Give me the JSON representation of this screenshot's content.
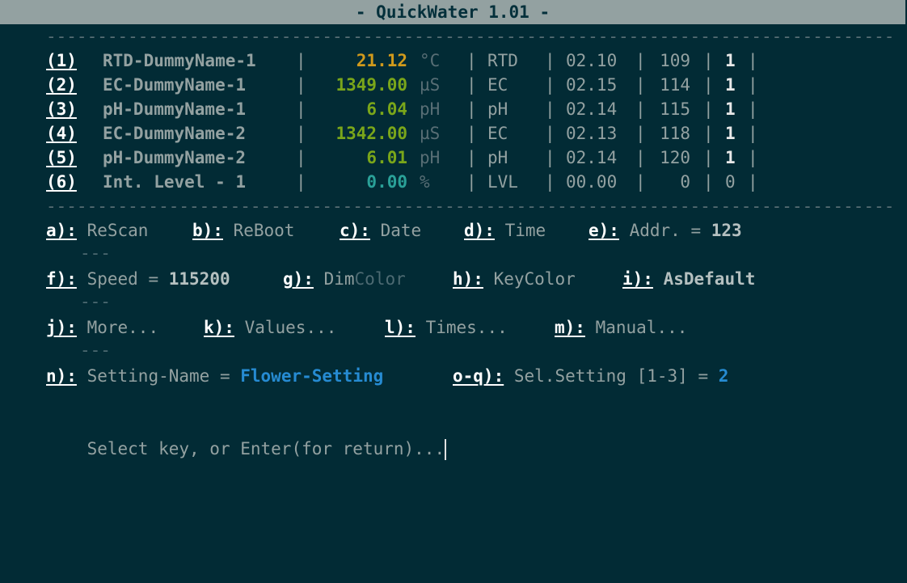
{
  "title": "- QuickWater 1.01 -",
  "rule": "-----------------------------------------------------------------------------------",
  "sensors": [
    {
      "key": "(1)",
      "name": "RTD-DummyName-1",
      "value": "21.12",
      "unit": "°C",
      "type": "RTD",
      "version": "02.10",
      "address": "109",
      "flag": "1",
      "color": "orange"
    },
    {
      "key": "(2)",
      "name": "EC-DummyName-1",
      "value": "1349.00",
      "unit": "µS",
      "type": "EC",
      "version": "02.15",
      "address": "114",
      "flag": "1",
      "color": "green"
    },
    {
      "key": "(3)",
      "name": "pH-DummyName-1",
      "value": "6.04",
      "unit": "pH",
      "type": "pH",
      "version": "02.14",
      "address": "115",
      "flag": "1",
      "color": "green"
    },
    {
      "key": "(4)",
      "name": "EC-DummyName-2",
      "value": "1342.00",
      "unit": "µS",
      "type": "EC",
      "version": "02.13",
      "address": "118",
      "flag": "1",
      "color": "green"
    },
    {
      "key": "(5)",
      "name": "pH-DummyName-2",
      "value": "6.01",
      "unit": "pH",
      "type": "pH",
      "version": "02.14",
      "address": "120",
      "flag": "1",
      "color": "green"
    },
    {
      "key": "(6)",
      "name": "Int. Level - 1",
      "value": "0.00",
      "unit": "%",
      "type": "LVL",
      "version": "00.00",
      "address": "0",
      "flag": "0",
      "color": "teal"
    }
  ],
  "separator": "|",
  "menu": {
    "a": {
      "key": "a):",
      "label": "ReScan"
    },
    "b": {
      "key": "b):",
      "label": "ReBoot"
    },
    "c": {
      "key": "c):",
      "label": "Date"
    },
    "d": {
      "key": "d):",
      "label": "Time"
    },
    "e": {
      "key": "e):",
      "label": "Addr. = ",
      "value": "123"
    },
    "f": {
      "key": "f):",
      "label": "Speed = ",
      "value": "115200"
    },
    "g": {
      "key": "g):",
      "label_a": "Dim",
      "label_b": "Color"
    },
    "h": {
      "key": "h):",
      "label": "KeyColor"
    },
    "i": {
      "key": "i):",
      "label": "AsDefault"
    },
    "j": {
      "key": "j):",
      "label": "More..."
    },
    "k": {
      "key": "k):",
      "label": "Values..."
    },
    "l": {
      "key": "l):",
      "label": "Times..."
    },
    "m": {
      "key": "m):",
      "label": "Manual..."
    },
    "n": {
      "key": "n):",
      "label": "Setting-Name = ",
      "value": "Flower-Setting"
    },
    "oq": {
      "key": "o-q):",
      "label": "Sel.Setting [1-3] = ",
      "value": "2"
    },
    "row_divider": "---"
  },
  "prompt": "Select key, or Enter(for return)...",
  "colors": {
    "background": "#022b35",
    "titlebar": "#93a1a1",
    "orange": "#d19a1c",
    "green": "#7aa61a",
    "teal": "#2aa198",
    "blue": "#268bd2"
  }
}
